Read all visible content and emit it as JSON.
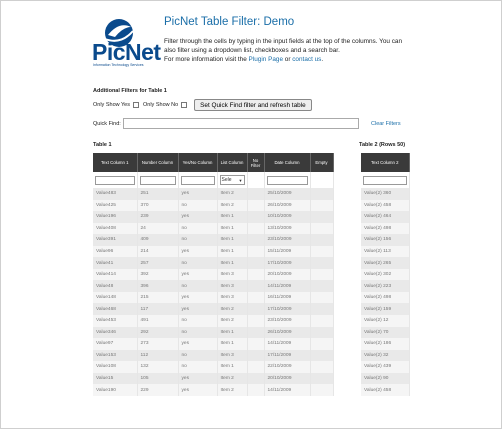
{
  "brand": {
    "name": "PicNet",
    "tagline": "Information Technology Services"
  },
  "header": {
    "title": "PicNet Table Filter: Demo",
    "intro_1": "Filter through the cells by typing in the input fields at the top of the columns. You can also filter using a dropdown list, checkboxes and a search bar.",
    "intro_2_prefix": "For more information visit the ",
    "plugin_link": "Plugin Page",
    "intro_2_mid": " or ",
    "contact_link": "contact us",
    "intro_2_suffix": "."
  },
  "filters": {
    "heading": "Additional Filters for Table 1",
    "only_yes": "Only Show Yes",
    "only_no": "Only Show No",
    "apply_button": "Set Quick Find filter and refresh table",
    "quick_find_label": "Quick Find:",
    "quick_find_value": "",
    "clear_link": "Clear Filters"
  },
  "table1": {
    "title": "Table 1",
    "columns": [
      "Text Column 1",
      "Number Column",
      "Yes/No Column",
      "List Column",
      "No Filter",
      "Date Column",
      "Empty"
    ],
    "select_value": "Sele",
    "rows": [
      [
        "Value483",
        "251",
        "yes",
        "Item 2",
        "",
        "25/10/2009",
        ""
      ],
      [
        "Value425",
        "370",
        "no",
        "Item 2",
        "",
        "26/10/2009",
        ""
      ],
      [
        "Value196",
        "239",
        "yes",
        "Item 1",
        "",
        "10/10/2009",
        ""
      ],
      [
        "Value408",
        "24",
        "no",
        "Item 1",
        "",
        "13/10/2009",
        ""
      ],
      [
        "Value391",
        "409",
        "no",
        "Item 1",
        "",
        "23/10/2009",
        ""
      ],
      [
        "Value96",
        "214",
        "yes",
        "Item 1",
        "",
        "15/11/2009",
        ""
      ],
      [
        "Value41",
        "257",
        "no",
        "Item 1",
        "",
        "17/10/2009",
        ""
      ],
      [
        "Value414",
        "392",
        "yes",
        "Item 3",
        "",
        "20/10/2009",
        ""
      ],
      [
        "Value48",
        "396",
        "no",
        "Item 3",
        "",
        "14/11/2009",
        ""
      ],
      [
        "Value148",
        "215",
        "yes",
        "Item 3",
        "",
        "16/11/2009",
        ""
      ],
      [
        "Value468",
        "117",
        "yes",
        "Item 2",
        "",
        "17/10/2009",
        ""
      ],
      [
        "Value453",
        "491",
        "no",
        "Item 2",
        "",
        "23/10/2009",
        ""
      ],
      [
        "Value346",
        "292",
        "no",
        "Item 1",
        "",
        "26/10/2009",
        ""
      ],
      [
        "Value97",
        "273",
        "yes",
        "Item 1",
        "",
        "14/11/2009",
        ""
      ],
      [
        "Value153",
        "112",
        "no",
        "Item 3",
        "",
        "17/11/2009",
        ""
      ],
      [
        "Value108",
        "132",
        "no",
        "Item 1",
        "",
        "22/10/2009",
        ""
      ],
      [
        "Value15",
        "105",
        "yes",
        "Item 2",
        "",
        "20/10/2009",
        ""
      ],
      [
        "Value190",
        "229",
        "yes",
        "Item 2",
        "",
        "14/11/2009",
        ""
      ]
    ]
  },
  "table2": {
    "title": "Table 2 (Rows 50)",
    "columns": [
      "Text Column 2"
    ],
    "rows": [
      "Value(2) 360",
      "Value(2) 458",
      "Value(2) 464",
      "Value(2) 498",
      "Value(2) 156",
      "Value(2) 113",
      "Value(2) 265",
      "Value(2) 302",
      "Value(2) 223",
      "Value(2) 498",
      "Value(2) 159",
      "Value(2) 12",
      "Value(2) 70",
      "Value(2) 186",
      "Value(2) 32",
      "Value(2) 439",
      "Value(2) 90",
      "Value(2) 458"
    ]
  },
  "colors": {
    "accent": "#1a6ea8",
    "header_bg": "#3a3a3a",
    "brand": "#0a4a8c"
  }
}
